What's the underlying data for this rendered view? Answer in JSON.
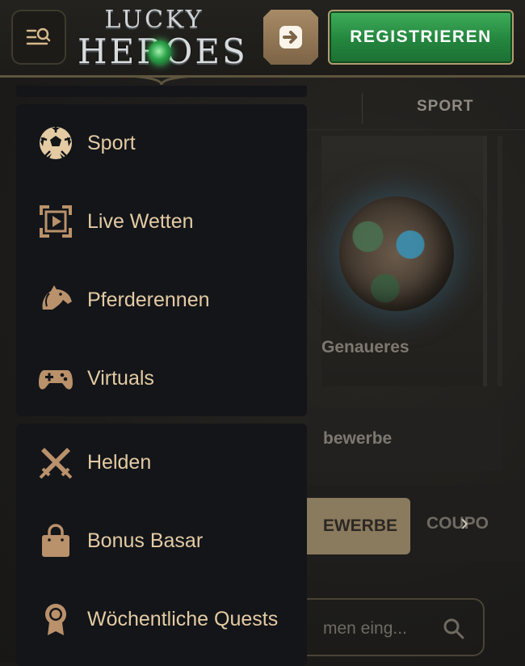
{
  "header": {
    "logo_line1": "LUCKY",
    "logo_line2": "HEROES",
    "register_label": "REGISTRIEREN"
  },
  "menu": {
    "group1": [
      {
        "label": "Sport",
        "icon": "soccer-ball-icon"
      },
      {
        "label": "Live Wetten",
        "icon": "live-play-icon"
      },
      {
        "label": "Pferderennen",
        "icon": "horse-icon"
      },
      {
        "label": "Virtuals",
        "icon": "gamepad-icon"
      }
    ],
    "group2": [
      {
        "label": "Helden",
        "icon": "crossed-swords-icon"
      },
      {
        "label": "Bonus Basar",
        "icon": "shopping-bag-icon"
      },
      {
        "label": "Wöchentliche Quests",
        "icon": "medal-icon"
      }
    ]
  },
  "background": {
    "tab_sport": "SPORT",
    "card_text": "Genaueres",
    "section_text": "bewerbe",
    "pill_text": "EWERBE",
    "coupon_text": "COUPO",
    "search_placeholder": "men eing..."
  },
  "colors": {
    "menu_text": "#e4cba3",
    "icon_color": "#b9916a",
    "panel_bg": "#131519",
    "register_green": "#2f9a4b",
    "login_bronze": "#9a7d5a"
  }
}
